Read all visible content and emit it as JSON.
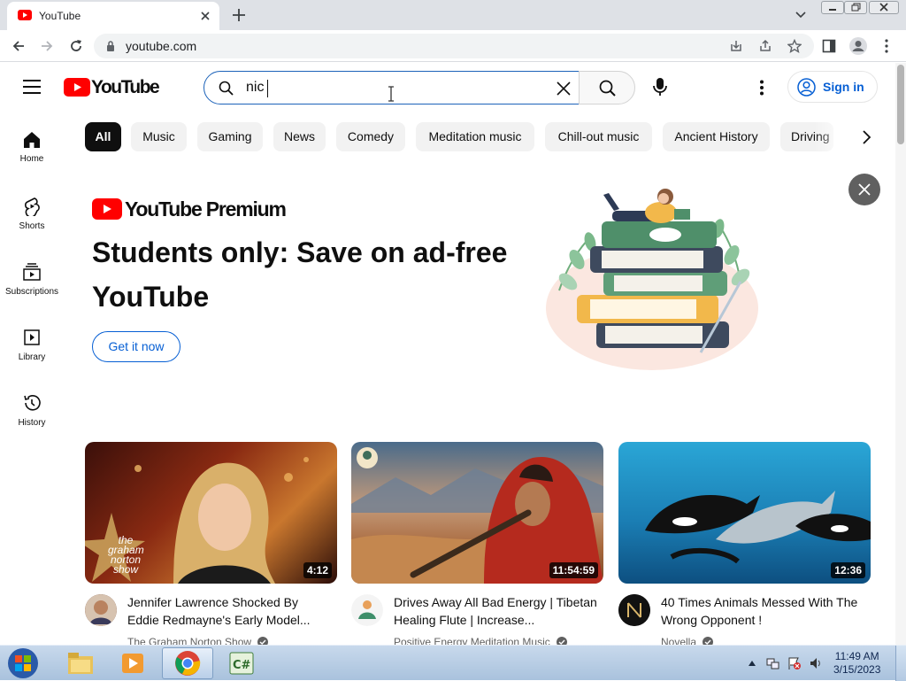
{
  "browser": {
    "tab_title": "YouTube",
    "url": "youtube.com"
  },
  "header": {
    "logo_text": "YouTube",
    "search_value": "nic",
    "signin_label": "Sign in"
  },
  "chips": [
    "All",
    "Music",
    "Gaming",
    "News",
    "Comedy",
    "Meditation music",
    "Chill-out music",
    "Ancient History",
    "Driving"
  ],
  "sidebar": {
    "items": [
      {
        "label": "Home",
        "icon": "home-icon"
      },
      {
        "label": "Shorts",
        "icon": "shorts-icon"
      },
      {
        "label": "Subscriptions",
        "icon": "subscriptions-icon"
      },
      {
        "label": "Library",
        "icon": "library-icon"
      },
      {
        "label": "History",
        "icon": "history-icon"
      }
    ]
  },
  "banner": {
    "brand": "YouTube Premium",
    "headline": "Students only: Save on ad-free YouTube",
    "cta": "Get it now"
  },
  "videos": [
    {
      "title": "Jennifer Lawrence Shocked By Eddie Redmayne's Early Model...",
      "channel": "The Graham Norton Show",
      "duration": "4:12",
      "thumb_watermark": "the graham norton show"
    },
    {
      "title": "Drives Away All Bad Energy | Tibetan Healing Flute | Increase...",
      "channel": "Positive Energy Meditation Music",
      "duration": "11:54:59"
    },
    {
      "title": "40 Times Animals Messed With The Wrong Opponent !",
      "channel": "Novella",
      "duration": "12:36"
    }
  ],
  "taskbar": {
    "time": "11:49 AM",
    "date": "3/15/2023"
  },
  "colors": {
    "youtube_red": "#ff0000",
    "link_blue": "#065fd4",
    "chip_bg": "#f2f2f2"
  }
}
